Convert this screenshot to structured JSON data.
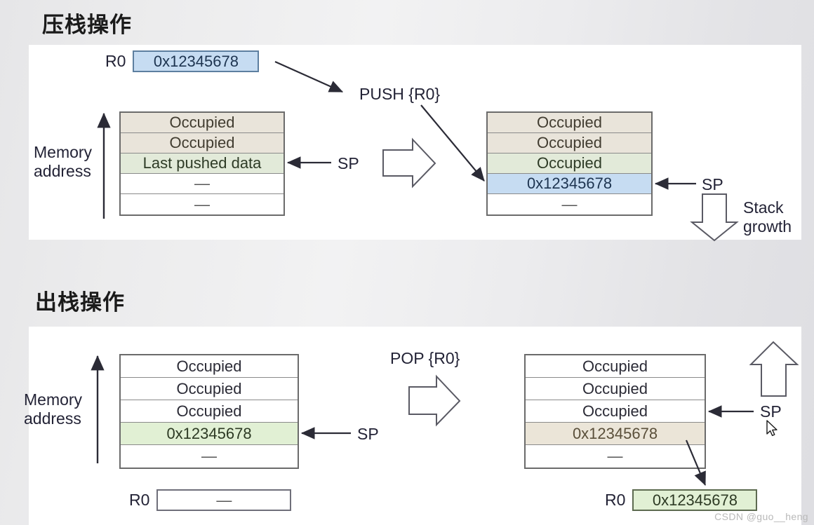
{
  "sections": [
    {
      "id": "push",
      "title": "压栈操作",
      "register_in": {
        "name": "R0",
        "value": "0x12345678"
      },
      "operation": "PUSH  {R0}",
      "axis_label_line1": "Memory",
      "axis_label_line2": "address",
      "sp_label_left": "SP",
      "sp_label_right": "SP",
      "growth_label_line1": "Stack",
      "growth_label_line2": "growth",
      "stack_before": [
        {
          "text": "Occupied",
          "style": "beige"
        },
        {
          "text": "Occupied",
          "style": "beige"
        },
        {
          "text": "Last pushed data",
          "style": "green"
        },
        {
          "text": "—",
          "style": "white"
        },
        {
          "text": "—",
          "style": "white"
        }
      ],
      "stack_after": [
        {
          "text": "Occupied",
          "style": "beige"
        },
        {
          "text": "Occupied",
          "style": "beige"
        },
        {
          "text": "Occupied",
          "style": "green"
        },
        {
          "text": "0x12345678",
          "style": "blue"
        },
        {
          "text": "—",
          "style": "white"
        }
      ]
    },
    {
      "id": "pop",
      "title": "出栈操作",
      "operation": "POP  {R0}",
      "axis_label_line1": "Memory",
      "axis_label_line2": "address",
      "sp_label_left": "SP",
      "sp_label_right": "SP",
      "stack_before": [
        {
          "text": "Occupied",
          "style": "white"
        },
        {
          "text": "Occupied",
          "style": "white"
        },
        {
          "text": "Occupied",
          "style": "white"
        },
        {
          "text": "0x12345678",
          "style": "greenB"
        },
        {
          "text": "—",
          "style": "white"
        }
      ],
      "stack_after": [
        {
          "text": "Occupied",
          "style": "white"
        },
        {
          "text": "Occupied",
          "style": "white"
        },
        {
          "text": "Occupied",
          "style": "white"
        },
        {
          "text": "0x12345678",
          "style": "tan"
        },
        {
          "text": "—",
          "style": "white"
        }
      ],
      "register_before": {
        "name": "R0",
        "value": "—"
      },
      "register_after": {
        "name": "R0",
        "value": "0x12345678"
      }
    }
  ],
  "watermark": "CSDN @guo__heng",
  "colors": {
    "beige": "#e9e4da",
    "green": "#e2ead9",
    "green_bright": "#e1f0d4",
    "blue": "#c6dcf2",
    "tan": "#ebe5d8",
    "stroke": "#555560",
    "panel": "#ffffff"
  }
}
